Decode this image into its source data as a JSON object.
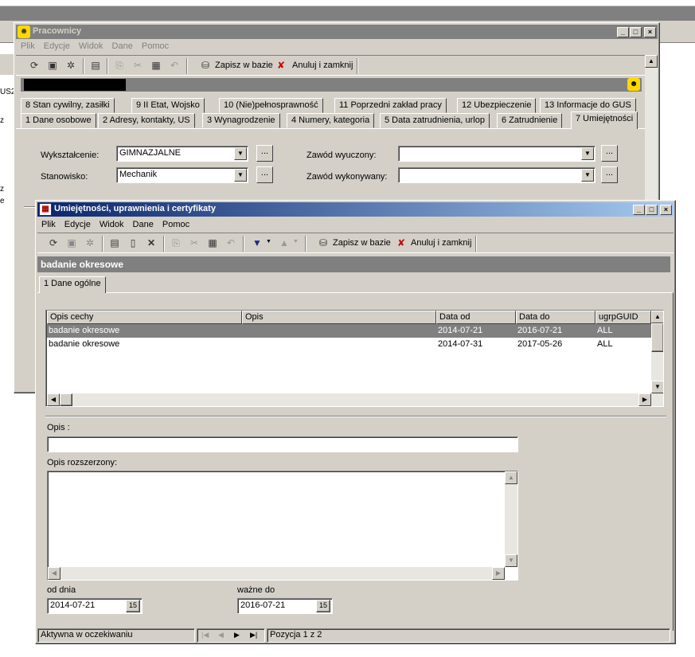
{
  "background_window": {
    "title": "Pracownicy",
    "menu": [
      "Plik",
      "Edycje",
      "Widok",
      "Dane",
      "Pomoc"
    ],
    "toolbar": {
      "save_label": "Zapisz w bazie",
      "cancel_label": "Anuluj i zamknij"
    },
    "tabs_row1": [
      "8  Stan cywilny, zasiłki",
      "9  II Etat, Wojsko",
      "10  (Nie)pełnosprawność",
      "11  Poprzedni zakład pracy",
      "12  Ubezpieczenie",
      "13 Informacje do GUS"
    ],
    "tabs_row2": [
      "1 Dane osobowe",
      "2 Adresy, kontakty, US",
      "3  Wynagrodzenie",
      "4  Numery, kategoria",
      "5  Data zatrudnienia, urlop",
      "6  Zatrudnienie",
      "7  Umiejętności"
    ],
    "fields": {
      "education_label": "Wykształcenie:",
      "education_value": "GIMNAZJALNE",
      "position_label": "Stanowisko:",
      "position_value": "Mechanik",
      "learned_profession_label": "Zawód wyuczony:",
      "learned_profession_value": "",
      "practiced_profession_label": "Zawód wykonywany:",
      "practiced_profession_value": "",
      "dots": "..."
    },
    "left_fragments": [
      "US2",
      "z",
      "z",
      "e"
    ]
  },
  "dialog": {
    "title": "Umiejętności, uprawnienia i certyfikaty",
    "menu": [
      "Plik",
      "Edycje",
      "Widok",
      "Dane",
      "Pomoc"
    ],
    "toolbar": {
      "save_label": "Zapisz w bazie",
      "cancel_label": "Anuluj i zamknij"
    },
    "header": "badanie okresowe",
    "tab": "1 Dane ogólne",
    "grid": {
      "columns": [
        "Opis cechy",
        "Opis",
        "Data od",
        "Data do",
        "ugrpGUID"
      ],
      "rows": [
        [
          "badanie okresowe",
          "",
          "2014-07-21",
          "2016-07-21",
          "ALL"
        ],
        [
          "badanie okresowe",
          "",
          "2014-07-31",
          "2017-05-26",
          "ALL"
        ]
      ],
      "selected_row": 0
    },
    "opis_label": "Opis :",
    "opis_value": "",
    "opis_ext_label": "Opis rozszerzony:",
    "opis_ext_value": "",
    "from_label": "od dnia",
    "from_value": "2014-07-21",
    "to_label": "ważne do",
    "to_value": "2016-07-21",
    "calendar_glyph": "15",
    "status_left": "Aktywna w oczekiwaniu",
    "status_right": "Pozycja 1 z 2"
  },
  "colors": {
    "face": "#d4d0c8",
    "active_title_start": "#0a246a",
    "active_title_end": "#a6caf0",
    "inactive_title": "#808080",
    "selection": "#808080"
  }
}
